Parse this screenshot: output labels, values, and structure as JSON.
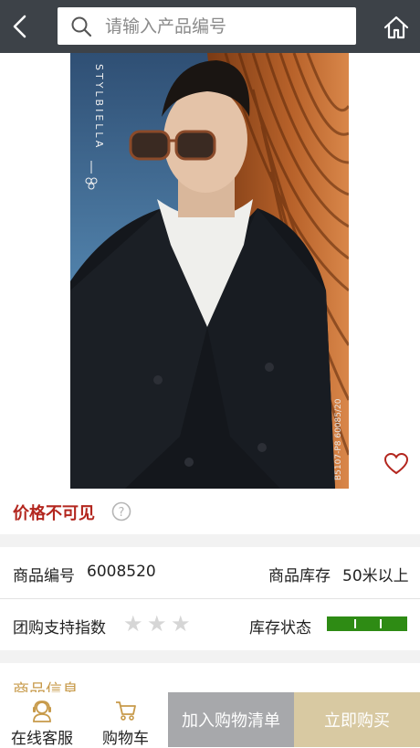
{
  "header": {
    "search_placeholder": "请输入产品编号"
  },
  "product": {
    "brand_logo_text": "STYLBIELLA",
    "image_code": "B5107-P8  60085/20"
  },
  "price": {
    "text": "价格不可见"
  },
  "details": {
    "code_label": "商品编号",
    "code_value": "6008520",
    "stock_label": "商品库存",
    "stock_value": "50米以上",
    "group_label": "团购支持指数",
    "group_rating": 0,
    "group_rating_max": 3,
    "stock_status_label": "库存状态"
  },
  "section": {
    "title": "商品信息"
  },
  "bottom": {
    "service_label": "在线客服",
    "cart_label": "购物车",
    "add_to_list_label": "加入购物清单",
    "buy_label": "立即购买"
  },
  "colors": {
    "header_bg": "#3d4248",
    "price_red": "#b3261e",
    "stock_green": "#2e8b14",
    "gold": "#c79a4a",
    "cart_button": "#a7a8ab",
    "buy_button": "#d8c9a2"
  }
}
